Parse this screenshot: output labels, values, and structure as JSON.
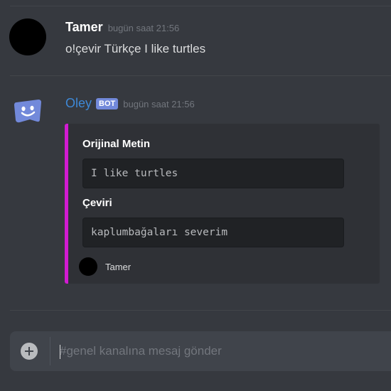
{
  "messages": [
    {
      "author": "Tamer",
      "timestamp": "bugün saat 21:56",
      "text": "o!çevir Türkçe I like turtles"
    },
    {
      "author": "Oley",
      "badge": "BOT",
      "timestamp": "bugün saat 21:56",
      "embed": {
        "accent_color": "#d21bd2",
        "fields": [
          {
            "name": "Orijinal Metin",
            "value": "I like turtles"
          },
          {
            "name": "Çeviri",
            "value": "kaplumbağaları severim"
          }
        ],
        "footer": {
          "text": "Tamer"
        }
      }
    }
  ],
  "composer": {
    "placeholder": "#genel kanalına mesaj gönder",
    "value": ""
  },
  "colors": {
    "background": "#36393f",
    "bot_name": "#3e88d6",
    "bot_badge": "#7289da",
    "embed_accent": "#d21bd2"
  },
  "icons": {
    "user_avatar": "black-circle-avatar",
    "bot_avatar": "discord-blurple-smiley-icon",
    "add": "plus-circle-icon"
  }
}
